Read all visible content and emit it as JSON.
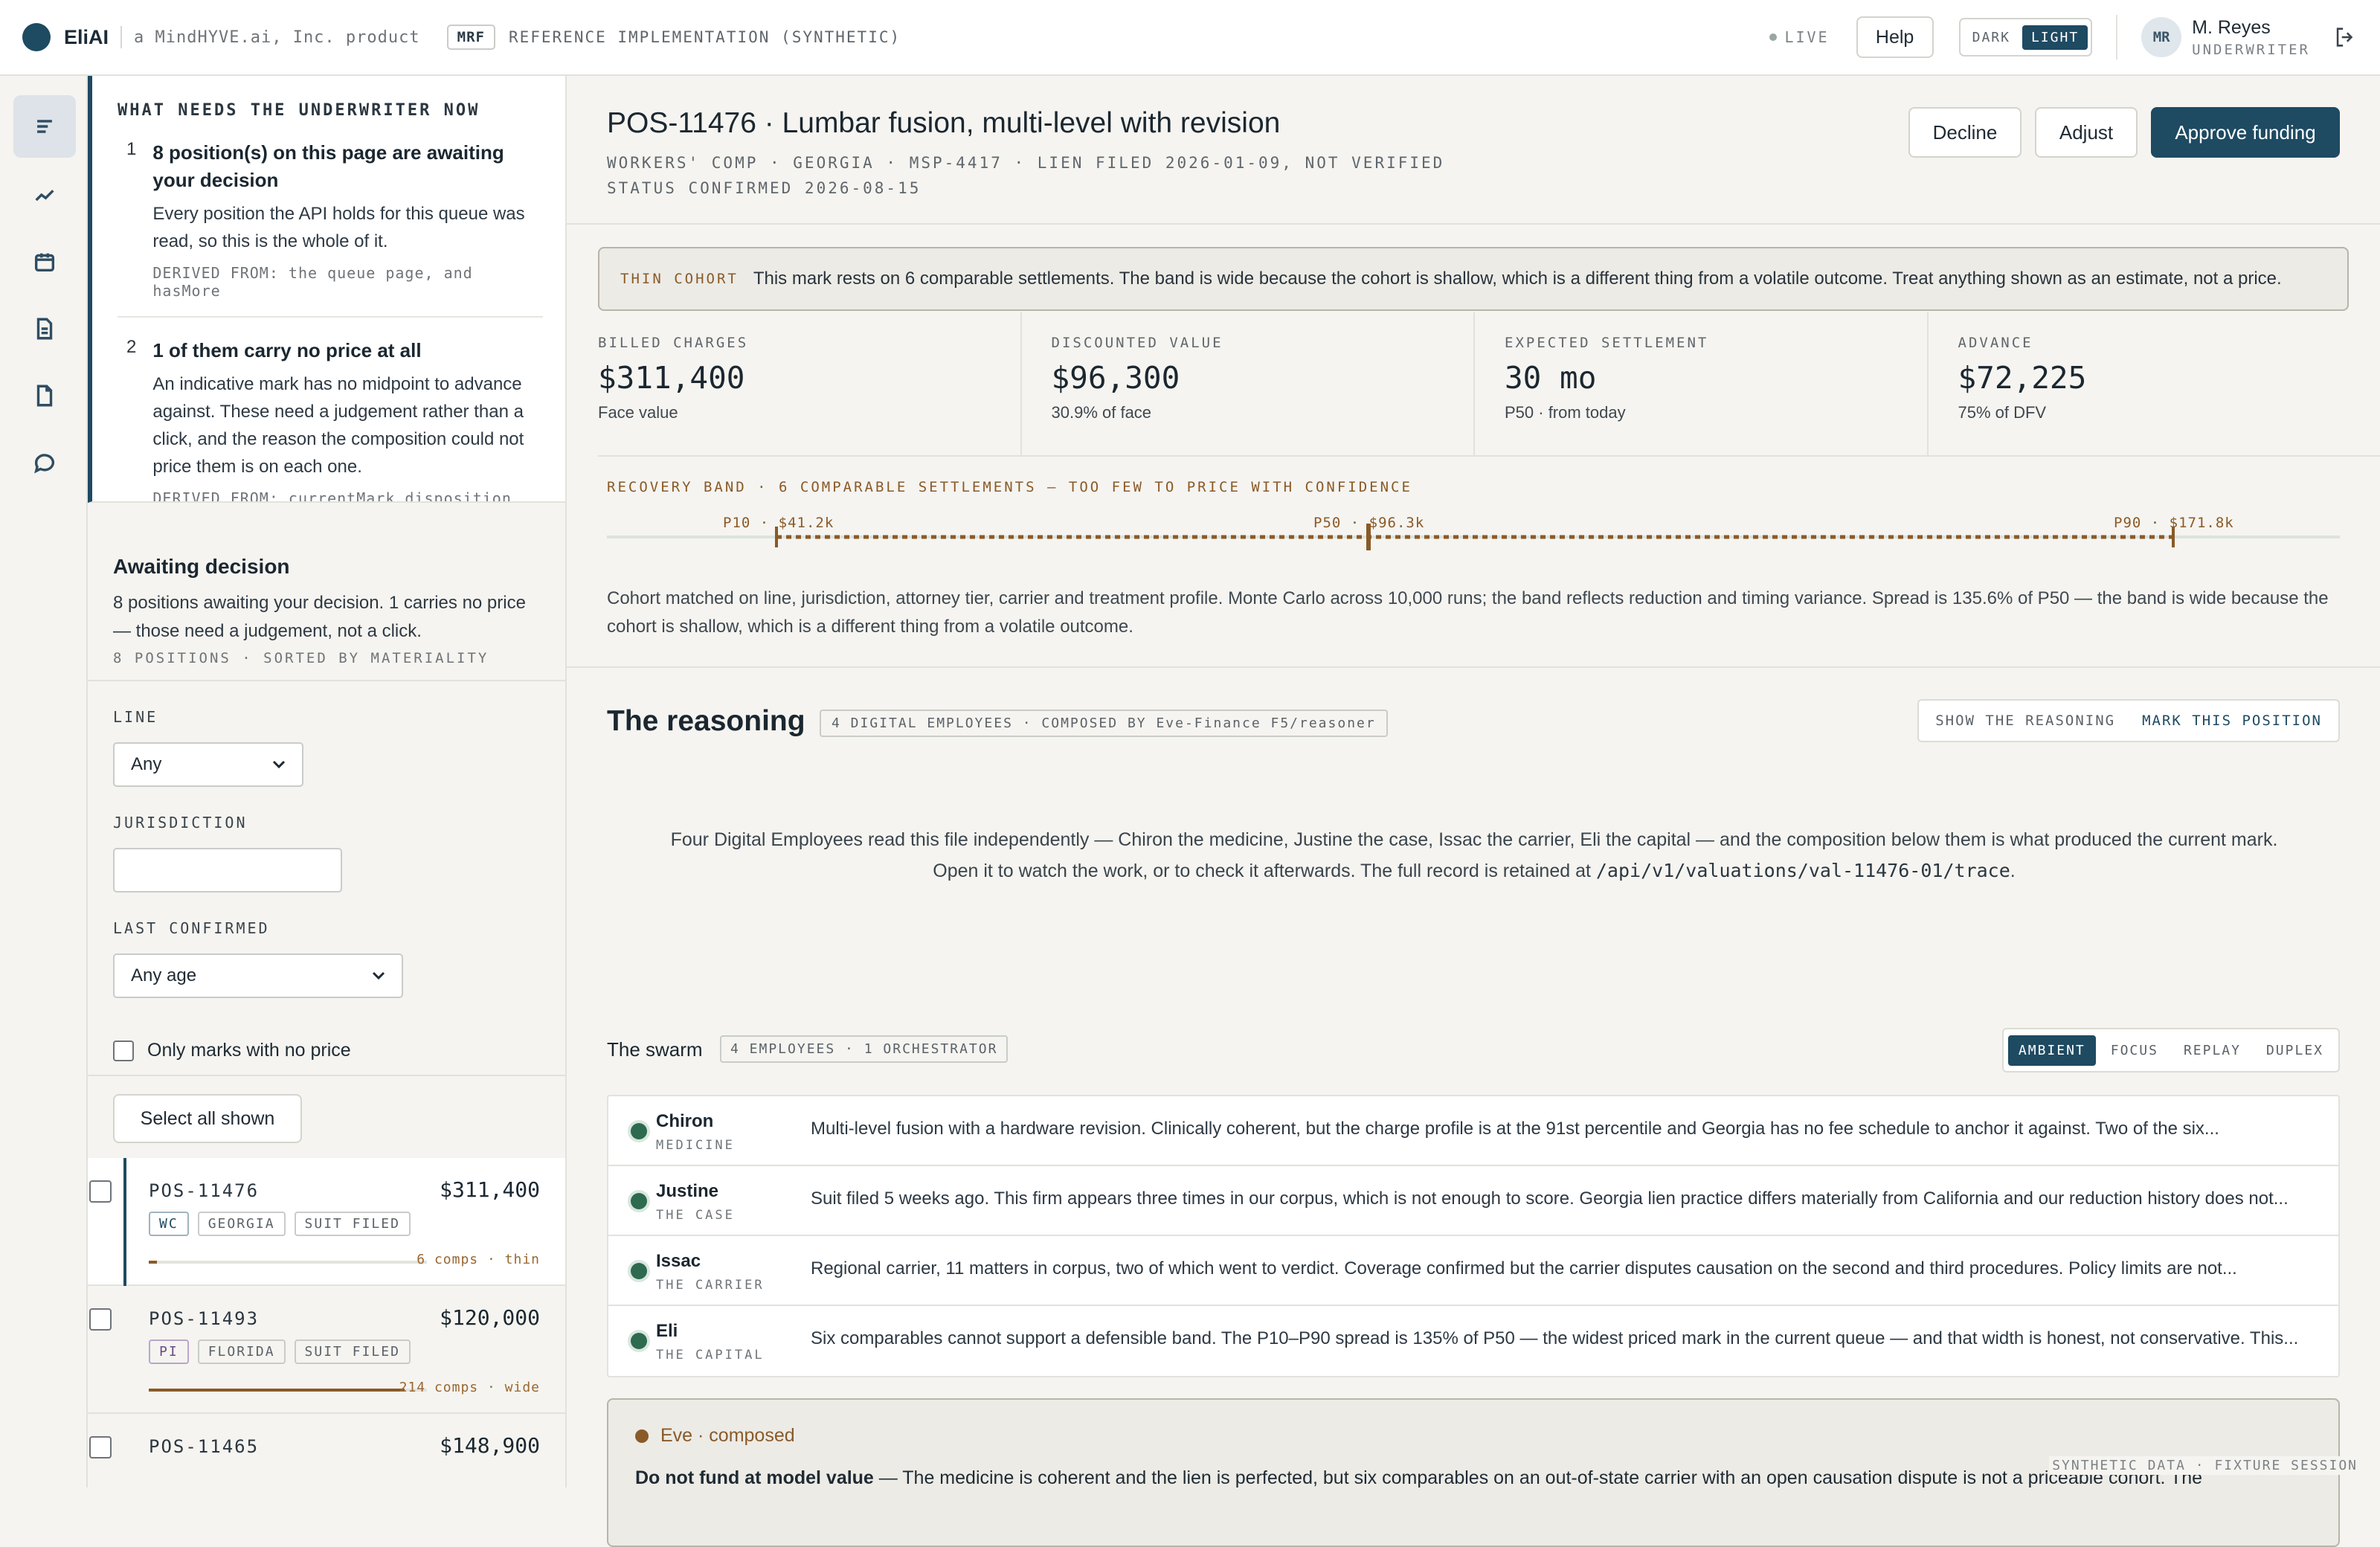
{
  "app": {
    "brand": "EliAI",
    "product_line": "a MindHYVE.ai, Inc. product",
    "badge": "MRF",
    "reference": "REFERENCE IMPLEMENTATION (SYNTHETIC)",
    "live": "LIVE",
    "help": "Help",
    "theme": {
      "dark": "DARK",
      "light": "LIGHT",
      "selected": "LIGHT"
    },
    "user": {
      "initials": "MR",
      "name": "M. Reyes",
      "role": "UNDERWRITER"
    },
    "accent": "#1e4a62"
  },
  "rail": {
    "items": [
      "menu-icon",
      "trend-icon",
      "calendar-icon",
      "document-icon",
      "file-icon",
      "chat-icon"
    ],
    "active": "menu-icon"
  },
  "needs": {
    "title": "WHAT NEEDS THE UNDERWRITER NOW",
    "items": [
      {
        "num": "1",
        "heading": "8 position(s) on this page are awaiting your decision",
        "body": "Every position the API holds for this queue was read, so this is the whole of it.",
        "derived": "DERIVED FROM: the queue page, and hasMore"
      },
      {
        "num": "2",
        "heading": "1 of them carry no price at all",
        "body": "An indicative mark has no midpoint to advance against. These need a judgement rather than a click, and the reason the composition could not price them is on each one.",
        "derived": "DERIVED FROM: currentMark.disposition"
      }
    ]
  },
  "queue": {
    "heading": "Awaiting decision",
    "summary": "8 positions awaiting your decision. 1 carries no price — those need a judgement, not a click.",
    "meta": "8 POSITIONS · SORTED BY MATERIALITY",
    "filters": {
      "line_label": "LINE",
      "line_value": "Any",
      "jurisdiction_label": "JURISDICTION",
      "jurisdiction_value": "",
      "confirmed_label": "LAST CONFIRMED",
      "confirmed_value": "Any age",
      "no_price_label": "Only marks with no price"
    },
    "select_all": "Select all shown",
    "positions": [
      {
        "id": "POS-11476",
        "amount": "$311,400",
        "tags": [
          "WC",
          "GEORGIA",
          "SUIT FILED"
        ],
        "comps": "6 comps · thin",
        "band": 0.03
      },
      {
        "id": "POS-11493",
        "amount": "$120,000",
        "tags": [
          "PI",
          "FLORIDA",
          "SUIT FILED"
        ],
        "comps": "214 comps · wide",
        "band": 0.92
      },
      {
        "id": "POS-11465",
        "amount": "$148,900",
        "tags": [],
        "comps": "",
        "band": 0
      }
    ]
  },
  "position": {
    "title": "POS-11476 · Lumbar fusion, multi-level with revision",
    "meta_line1": "WORKERS' COMP · GEORGIA · MSP-4417 · LIEN FILED 2026-01-09, NOT VERIFIED",
    "meta_line2": "STATUS CONFIRMED 2026-08-15",
    "actions": {
      "decline": "Decline",
      "adjust": "Adjust",
      "approve": "Approve funding"
    },
    "cohort": {
      "label": "THIN COHORT",
      "text": "This mark rests on 6 comparable settlements. The band is wide because the cohort is shallow, which is a different thing from a volatile outcome. Treat anything shown as an estimate, not a price."
    },
    "metrics": [
      {
        "label": "BILLED CHARGES",
        "value": "$311,400",
        "sub": "Face value"
      },
      {
        "label": "DISCOUNTED VALUE",
        "value": "$96,300",
        "sub": "30.9% of face"
      },
      {
        "label": "EXPECTED SETTLEMENT",
        "value": "30 mo",
        "sub": "P50 · from today"
      },
      {
        "label": "ADVANCE",
        "value": "$72,225",
        "sub": "75% of DFV"
      }
    ],
    "band": {
      "label": "RECOVERY BAND · 6 COMPARABLE SETTLEMENTS — TOO FEW TO PRICE WITH CONFIDENCE",
      "p10": "P10 · $41.2k",
      "p50": "P50 · $96.3k",
      "p90": "P90 · $171.8k",
      "description": "Cohort matched on line, jurisdiction, attorney tier, carrier and treatment profile. Monte Carlo across 10,000 runs; the band reflects reduction and timing variance. Spread is 135.6% of P50 — the band is wide because the cohort is shallow, which is a different thing from a volatile outcome."
    }
  },
  "reasoning": {
    "title": "The reasoning",
    "badge": "4 DIGITAL EMPLOYEES · COMPOSED BY Eve-Finance F5/reasoner",
    "toggle": {
      "show": "SHOW THE REASONING",
      "mark": "MARK THIS POSITION"
    },
    "intro": "Four Digital Employees read this file independently — Chiron the medicine, Justine the case, Issac the carrier, Eli the capital — and the composition below them is what produced the current mark. Open it to watch the work, or to check it afterwards. The full record is retained at",
    "trace": "/api/v1/valuations/val-11476-01/trace",
    "swarm": {
      "title": "The swarm",
      "badge": "4 EMPLOYEES · 1 ORCHESTRATOR",
      "modes": [
        "AMBIENT",
        "FOCUS",
        "REPLAY",
        "DUPLEX"
      ],
      "active_mode": "AMBIENT",
      "employees": [
        {
          "name": "Chiron",
          "role": "MEDICINE",
          "text": "Multi-level fusion with a hardware revision. Clinically coherent, but the charge profile is at the 91st percentile and Georgia has no fee schedule to anchor it against. Two of the six..."
        },
        {
          "name": "Justine",
          "role": "THE CASE",
          "text": "Suit filed 5 weeks ago. This firm appears three times in our corpus, which is not enough to score. Georgia lien practice differs materially from California and our reduction history does not..."
        },
        {
          "name": "Issac",
          "role": "THE CARRIER",
          "text": "Regional carrier, 11 matters in corpus, two of which went to verdict. Coverage confirmed but the carrier disputes causation on the second and third procedures. Policy limits are not..."
        },
        {
          "name": "Eli",
          "role": "THE CAPITAL",
          "text": "Six comparables cannot support a defensible band. The P10–P90 spread is 135% of P50 — the widest priced mark in the current queue — and that width is honest, not conservative. This..."
        }
      ]
    },
    "eve": {
      "heading": "Eve · composed",
      "lead": "Do not fund at model value",
      "text": " — The medicine is coherent and the lien is perfected, but six comparables on an out-of-state carrier with an open causation dispute is not a priceable cohort. The"
    }
  },
  "footer": "SYNTHETIC DATA · FIXTURE SESSION"
}
